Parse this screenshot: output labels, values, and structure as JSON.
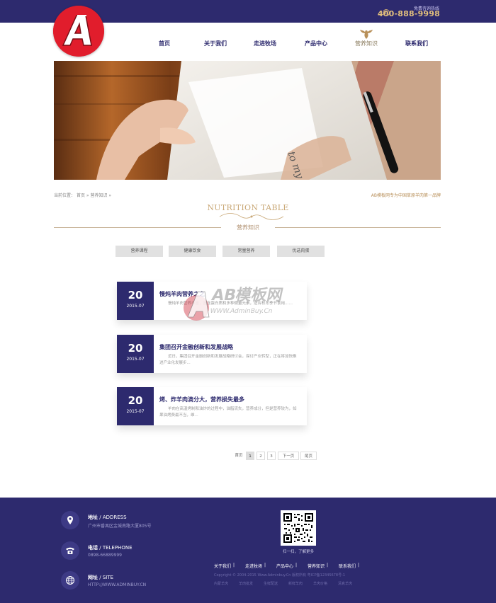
{
  "topbar": {
    "hotline_label": "免费咨询热线",
    "hotline_number": "400-888-9998"
  },
  "logo": {
    "letter": "A"
  },
  "nav": {
    "items": [
      {
        "label": "首页"
      },
      {
        "label": "关于我们"
      },
      {
        "label": "走进牧场"
      },
      {
        "label": "产品中心"
      },
      {
        "label": "营养知识"
      },
      {
        "label": "联系我们"
      }
    ]
  },
  "breadcrumb": {
    "prefix": "当前位置：",
    "home": "首页",
    "sep": "»",
    "current": "营养知识",
    "tail": "»"
  },
  "slogan": "AB模板网专为中国草原羊肉第一品牌",
  "section": {
    "title_en": "NUTRITION TABLE",
    "title_cn": "营养知识"
  },
  "tabs": [
    "营养课程",
    "健康饮食",
    "常量营养",
    "优选肉蛋"
  ],
  "news": [
    {
      "day": "20",
      "ym": "2015-07",
      "title": "慢炖羊肉营养之之",
      "desc": "慢炖羊肉营养丰富，富含蛋白质和多种微量元素，适合秋冬季节食用……"
    },
    {
      "day": "20",
      "ym": "2015-07",
      "title": "集团召开金融创新和发展战略",
      "desc": "近日，集团召开金融创新和发展战略研讨会，探讨产业转型，正在将加快推进产业化发展步..."
    },
    {
      "day": "20",
      "ym": "2015-07",
      "title": "烤、炸羊肉滴分大，营养损失最多",
      "desc": "羊肉在高温烤制和油炸的过程中，油脂流失，营养成分，但是营养较为，如果油烤费最不当，维..."
    }
  ],
  "watermark": {
    "brand": "AB模板网",
    "url": "WWW.AdminBuy.Cn"
  },
  "pagination": {
    "first": "首页",
    "pages": [
      "1",
      "2",
      "3"
    ],
    "next": "下一页",
    "last": "尾页"
  },
  "footer": {
    "address_label": "地址",
    "address_en": "ADDRESS",
    "address_value": "广州市番禺区金城南路大厦805号",
    "phone_label": "电话",
    "phone_en": "TELEPHONE",
    "phone_value": "0898-66889999",
    "site_label": "网址",
    "site_en": "SITE",
    "site_value": "HTTP://WWW.ADMINBUY.CN",
    "qr_caption": "扫一扫，了解更多",
    "links": [
      "关于我们",
      "走进牧场",
      "产品中心",
      "营养知识",
      "联系我们"
    ],
    "copyright": "Copyright © 2004-2015 Www.Adminbuy.Cn 版权所有  粤ICP备12345678号-1",
    "tags": [
      "内蒙羊肉",
      "羊肉批发",
      "生鲜配送",
      "新鲜羊肉",
      "羊肉价格",
      "清真羊肉"
    ]
  },
  "colors": {
    "brand_navy": "#2d2a6e",
    "gold": "#c9a877",
    "logo_red": "#e11d2c"
  }
}
